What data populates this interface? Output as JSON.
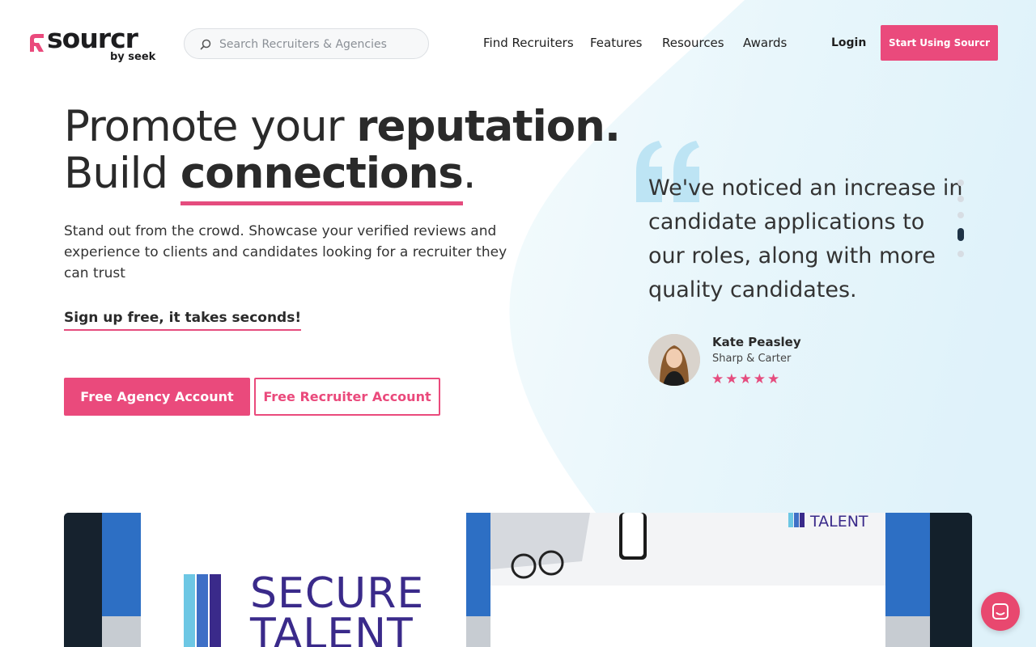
{
  "brand": {
    "name": "sourcr",
    "subtitle": "by seek",
    "accent": "#ea4a7c",
    "dark": "#1f3346",
    "light_blue": "#e2f3fa"
  },
  "header": {
    "search": {
      "placeholder": "Search Recruiters & Agencies",
      "value": ""
    },
    "nav": [
      "Find Recruiters",
      "Features",
      "Resources",
      "Awards"
    ],
    "login_label": "Login",
    "cta_label": "Start Using Sourcr"
  },
  "hero": {
    "headline_line1_light": "Promote your ",
    "headline_line1_bold": "reputation.",
    "headline_line2_light": "Build ",
    "headline_line2_bold": "connections",
    "headline_line2_end": ".",
    "lead": "Stand out from the crowd. Showcase your verified reviews and experience to clients and candidates looking for a recruiter they can trust",
    "signup_text": "Sign up free, it takes seconds!",
    "btn_agency": "Free Agency Account",
    "btn_recruiter": "Free Recruiter Account"
  },
  "testimonial": {
    "quote": "We've noticed an increase in candidate applications to our roles, along with more quality candidates.",
    "name": "Kate Peasley",
    "company": "Sharp & Carter",
    "rating": 5,
    "stars_text": "★★★★★",
    "slide_count": 5,
    "active_slide": 4
  },
  "video": {
    "logo_line1": "SECURE",
    "logo_line2": "TALENT",
    "small_logo": "TALENT"
  },
  "icons": {
    "search": "search-icon",
    "chat": "chat-icon",
    "quote": "quote-icon",
    "star": "star-icon"
  }
}
